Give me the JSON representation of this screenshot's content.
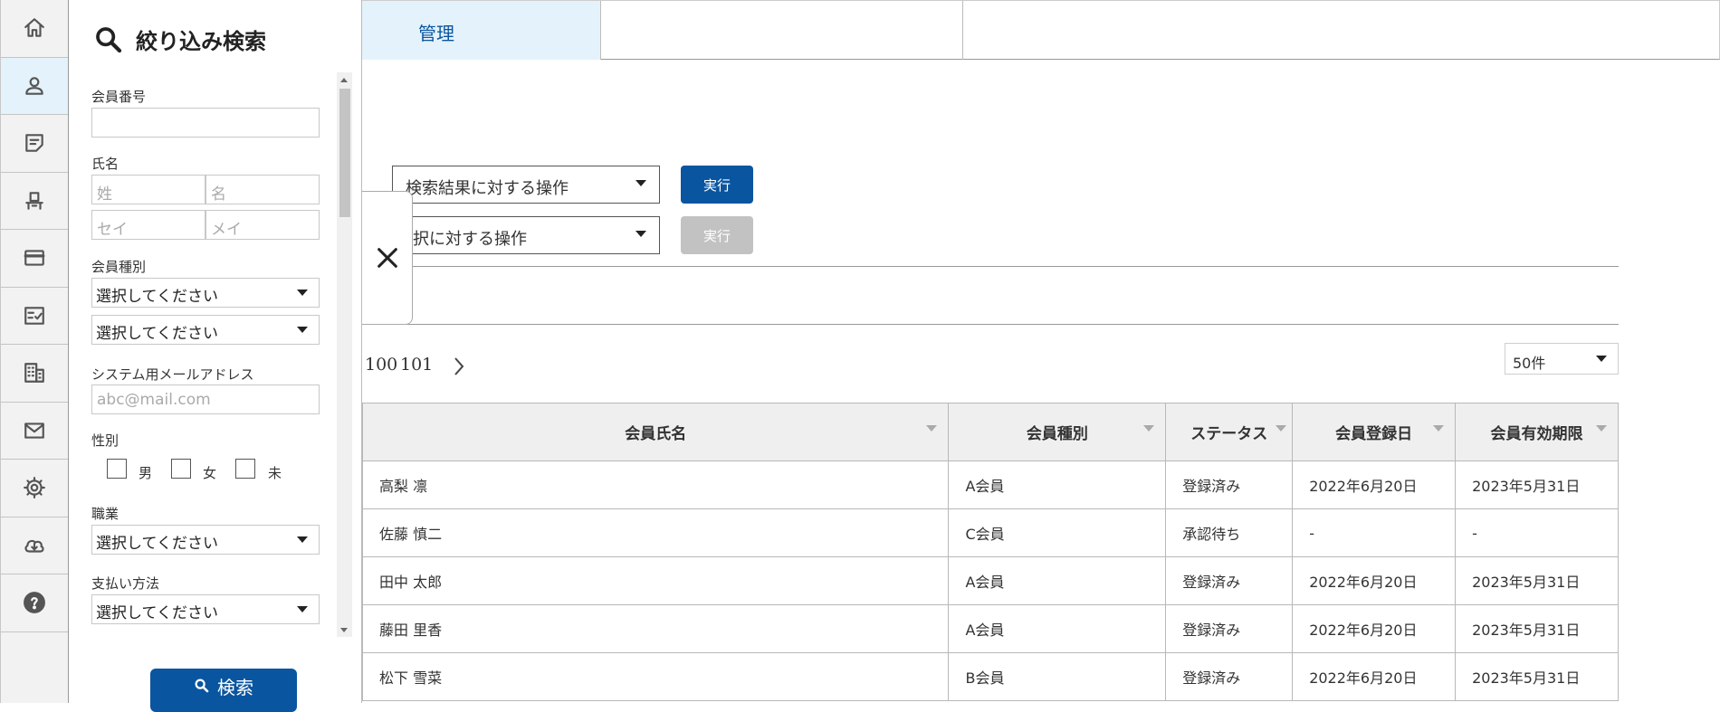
{
  "rail": {
    "items": [
      {
        "icon": "home-icon",
        "active": false
      },
      {
        "icon": "user-icon",
        "active": true
      },
      {
        "icon": "memo-icon",
        "active": false
      },
      {
        "icon": "seat-icon",
        "active": false
      },
      {
        "icon": "credit-card-icon",
        "active": false
      },
      {
        "icon": "checklist-icon",
        "active": false
      },
      {
        "icon": "building-icon",
        "active": false
      },
      {
        "icon": "mail-icon",
        "active": false
      },
      {
        "icon": "gear-icon",
        "active": false
      },
      {
        "icon": "cloud-download-icon",
        "active": false
      },
      {
        "icon": "help-icon",
        "active": false
      }
    ]
  },
  "topbar": {
    "active_tab_label": "管理"
  },
  "filter_panel": {
    "title": "絞り込み検索",
    "member_number_label": "会員番号",
    "name_label": "氏名",
    "last_name_placeholder": "姓",
    "first_name_placeholder": "名",
    "last_kana_placeholder": "セイ",
    "first_kana_placeholder": "メイ",
    "member_type_label": "会員種別",
    "member_type_select1": "選択してください",
    "member_type_select2": "選択してください",
    "email_label": "システム用メールアドレス",
    "email_placeholder": "abc@mail.com",
    "gender_label": "性別",
    "gender_male": "男",
    "gender_female": "女",
    "gender_unknown": "未",
    "occupation_label": "職業",
    "occupation_select": "選択してください",
    "payment_label": "支払い方法",
    "payment_select": "選択してください",
    "search_button": "検索"
  },
  "operations": {
    "results_op": "検索結果に対する操作",
    "selection_op": "選択に対する操作",
    "exec_label": "実行",
    "exec_label_disabled": "実行"
  },
  "pagination": {
    "page_a": "100",
    "page_b": "101"
  },
  "per_page": "50件",
  "table": {
    "headers": [
      "会員氏名",
      "会員種別",
      "ステータス",
      "会員登録日",
      "会員有効期限"
    ],
    "rows": [
      [
        "高梨 凛",
        "A会員",
        "登録済み",
        "2022年6月20日",
        "2023年5月31日"
      ],
      [
        "佐藤 慎二",
        "C会員",
        "承認待ち",
        "-",
        "-"
      ],
      [
        "田中 太郎",
        "A会員",
        "登録済み",
        "2022年6月20日",
        "2023年5月31日"
      ],
      [
        "藤田 里香",
        "A会員",
        "登録済み",
        "2022年6月20日",
        "2023年5月31日"
      ],
      [
        "松下 雪菜",
        "B会員",
        "登録済み",
        "2022年6月20日",
        "2023年5月31日"
      ]
    ]
  },
  "colors": {
    "accent": "#0a55a0",
    "active_bg": "#e4f2fb",
    "disabled": "#c2c2c2"
  }
}
